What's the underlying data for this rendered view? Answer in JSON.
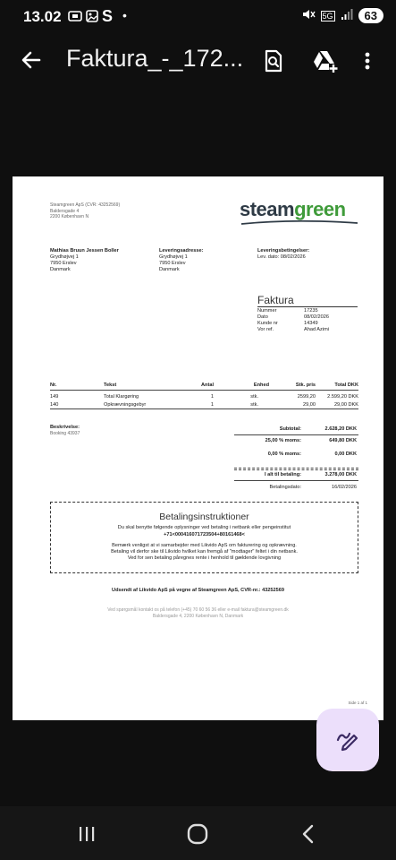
{
  "status_bar": {
    "time": "13.02",
    "network": "5G",
    "battery": "63"
  },
  "app_bar": {
    "title": "Faktura_-_172..."
  },
  "document": {
    "sender": {
      "line1": "Steamgreen ApS (CVR: 43252569)",
      "line2": "Baldersgade 4",
      "line3": "2200 København N"
    },
    "logo": {
      "part1": "steam",
      "part2": "green"
    },
    "customer": {
      "heading": "Mathias Bruun Jessen Boller",
      "line1": "Grydhøjvej 1",
      "line2": "7950 Erslev",
      "line3": "Danmark"
    },
    "delivery_address": {
      "heading": "Leveringsadresse:",
      "line1": "Grydhøjvej 1",
      "line2": "7950 Erslev",
      "line3": "Danmark"
    },
    "delivery_terms": {
      "heading": "Leveringsbetingelser:",
      "line1": "Lev. dato: 08/02/2026"
    },
    "invoice": {
      "title": "Faktura",
      "fields": [
        {
          "label": "Nummer",
          "value": "17235"
        },
        {
          "label": "Dato",
          "value": "08/02/2026"
        },
        {
          "label": "Kunde nr",
          "value": "14349"
        },
        {
          "label": "Vor ref.",
          "value": "Ahad Azimi"
        }
      ]
    },
    "table": {
      "headers": {
        "nr": "Nr.",
        "text": "Tekst",
        "qty": "Antal",
        "unit": "Enhed",
        "price": "Stk. pris",
        "total": "Total DKK"
      },
      "rows": [
        {
          "nr": "149",
          "text": "Total Klargøring",
          "qty": "1",
          "unit": "stk.",
          "price": "2599,20",
          "total": "2.599,20 DKK"
        },
        {
          "nr": "140",
          "text": "Opkrævningsgebyr",
          "qty": "1",
          "unit": "stk.",
          "price": "29,00",
          "total": "29,00 DKK"
        }
      ]
    },
    "description": {
      "heading": "Beskrivelse:",
      "text": "Booking 43937"
    },
    "totals": {
      "subtotal_label": "Subtotal:",
      "subtotal": "2.628,20 DKK",
      "vat1_label": "25,00 % moms:",
      "vat1": "649,80 DKK",
      "vat2_label": "0,00 % moms:",
      "vat2": "0,00 DKK",
      "total_label": "I alt til betaling:",
      "total": "3.278,00 DKK",
      "paydate_label": "Betalingsdato:",
      "paydate": "16/02/2026"
    },
    "payment": {
      "title": "Betalingsinstruktioner",
      "line1": "Du skal benytte følgende oplysninger ved betaling i netbank eller pengeinstitut",
      "code": "+71<000416071723504+80161468<",
      "line2": "Bemærk venligst at vi samarbejder med Likvido ApS om fakturering og opkrævning.",
      "line3": "Betaling vil derfor ske til Likvido hvilket kan fremgå af \"modtager\" feltet i din netbank.",
      "line4": "Ved for sen betaling påregnes rente i henhold til gældende lovgivning"
    },
    "footer": {
      "sent": "Udsendt af Likvido ApS på vegne af Steamgreen ApS, CVR-nr.: 43252569",
      "contact": "Ved spørgsmål kontakt os på telefon (+45) 70 60 56 36 eller e-mail faktura@steamgreen.dk",
      "address": "Baldersgade 4, 2200 København N, Danmark",
      "page": "Side 1 af 1"
    }
  }
}
